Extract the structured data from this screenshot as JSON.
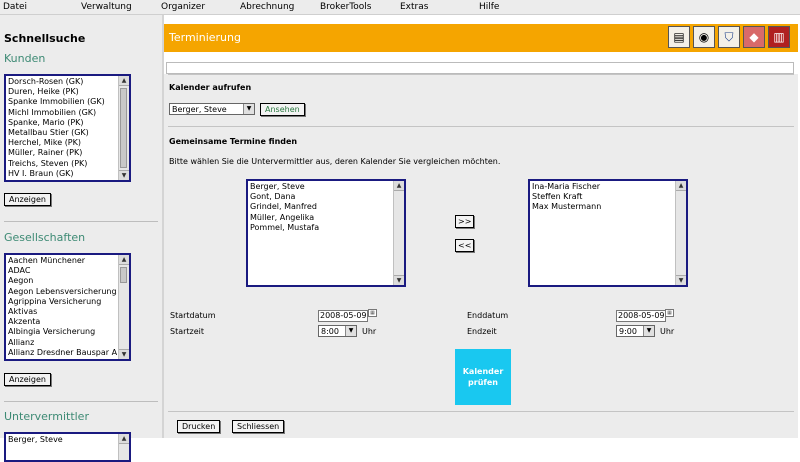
{
  "menu": [
    "Datei",
    "Verwaltung",
    "Organizer",
    "Abrechnung",
    "BrokerTools",
    "Extras",
    "Hilfe"
  ],
  "sidebar": {
    "title": "Schnellsuche",
    "kunden": {
      "heading": "Kunden",
      "items": [
        "Dorsch-Rosen (GK)",
        "Duren, Heike (PK)",
        "Spanke Immobilien (GK)",
        "Michl Immobilien (GK)",
        "Spanke, Mario (PK)",
        "Metallbau Stier (GK)",
        "Herchel, Mike (PK)",
        "Müller, Rainer (PK)",
        "Treichs, Steven (PK)",
        "HV I. Braun (GK)"
      ],
      "button": "Anzeigen"
    },
    "gesellschaften": {
      "heading": "Gesellschaften",
      "items": [
        "Aachen Münchener",
        "ADAC",
        "Aegon",
        "Aegon Lebensversicherungs",
        "Agrippina Versicherung",
        "Aktivas",
        "Akzenta",
        "Albingia Versicherung",
        "Allianz",
        "Allianz Dresdner Bauspar AG"
      ],
      "button": "Anzeigen"
    },
    "untervermittler": {
      "heading": "Untervermittler",
      "items": [
        "Berger, Steve"
      ]
    }
  },
  "main": {
    "title": "Terminierung",
    "toolbar_icons": [
      "document-icon",
      "eye-icon",
      "shield-icon",
      "pink-card-icon",
      "trash-icon"
    ],
    "kalender": {
      "heading": "Kalender aufrufen",
      "selected": "Berger, Steve",
      "button": "Ansehen"
    },
    "gemeinsame": {
      "heading": "Gemeinsame Termine finden",
      "instruction": "Bitte wählen Sie die Untervermittler aus, deren Kalender Sie vergleichen möchten.",
      "left_list": [
        "Berger, Steve",
        "Gont, Dana",
        "Grindel, Manfred",
        "Müller, Angelika",
        "Pommel, Mustafa"
      ],
      "right_list": [
        "Ina-Maria Fischer",
        "Steffen Kraft",
        "Max Mustermann"
      ],
      "add_button": ">>",
      "remove_button": "<<"
    },
    "form": {
      "startdatum_label": "Startdatum",
      "startdatum": "2008-05-09",
      "startzeit_label": "Startzeit",
      "startzeit": "8:00",
      "enddatum_label": "Enddatum",
      "enddatum": "2008-05-09",
      "endzeit_label": "Endzeit",
      "endzeit": "9:00",
      "uhr": "Uhr"
    },
    "pruefen_button": "Kalender prüfen",
    "footer": {
      "drucken": "Drucken",
      "schliessen": "Schliessen"
    }
  },
  "colors": {
    "accent_orange": "#f5a500",
    "heading_teal": "#3d8a74",
    "pruefen_blue": "#19c8f0",
    "list_border": "#1a1a80"
  }
}
